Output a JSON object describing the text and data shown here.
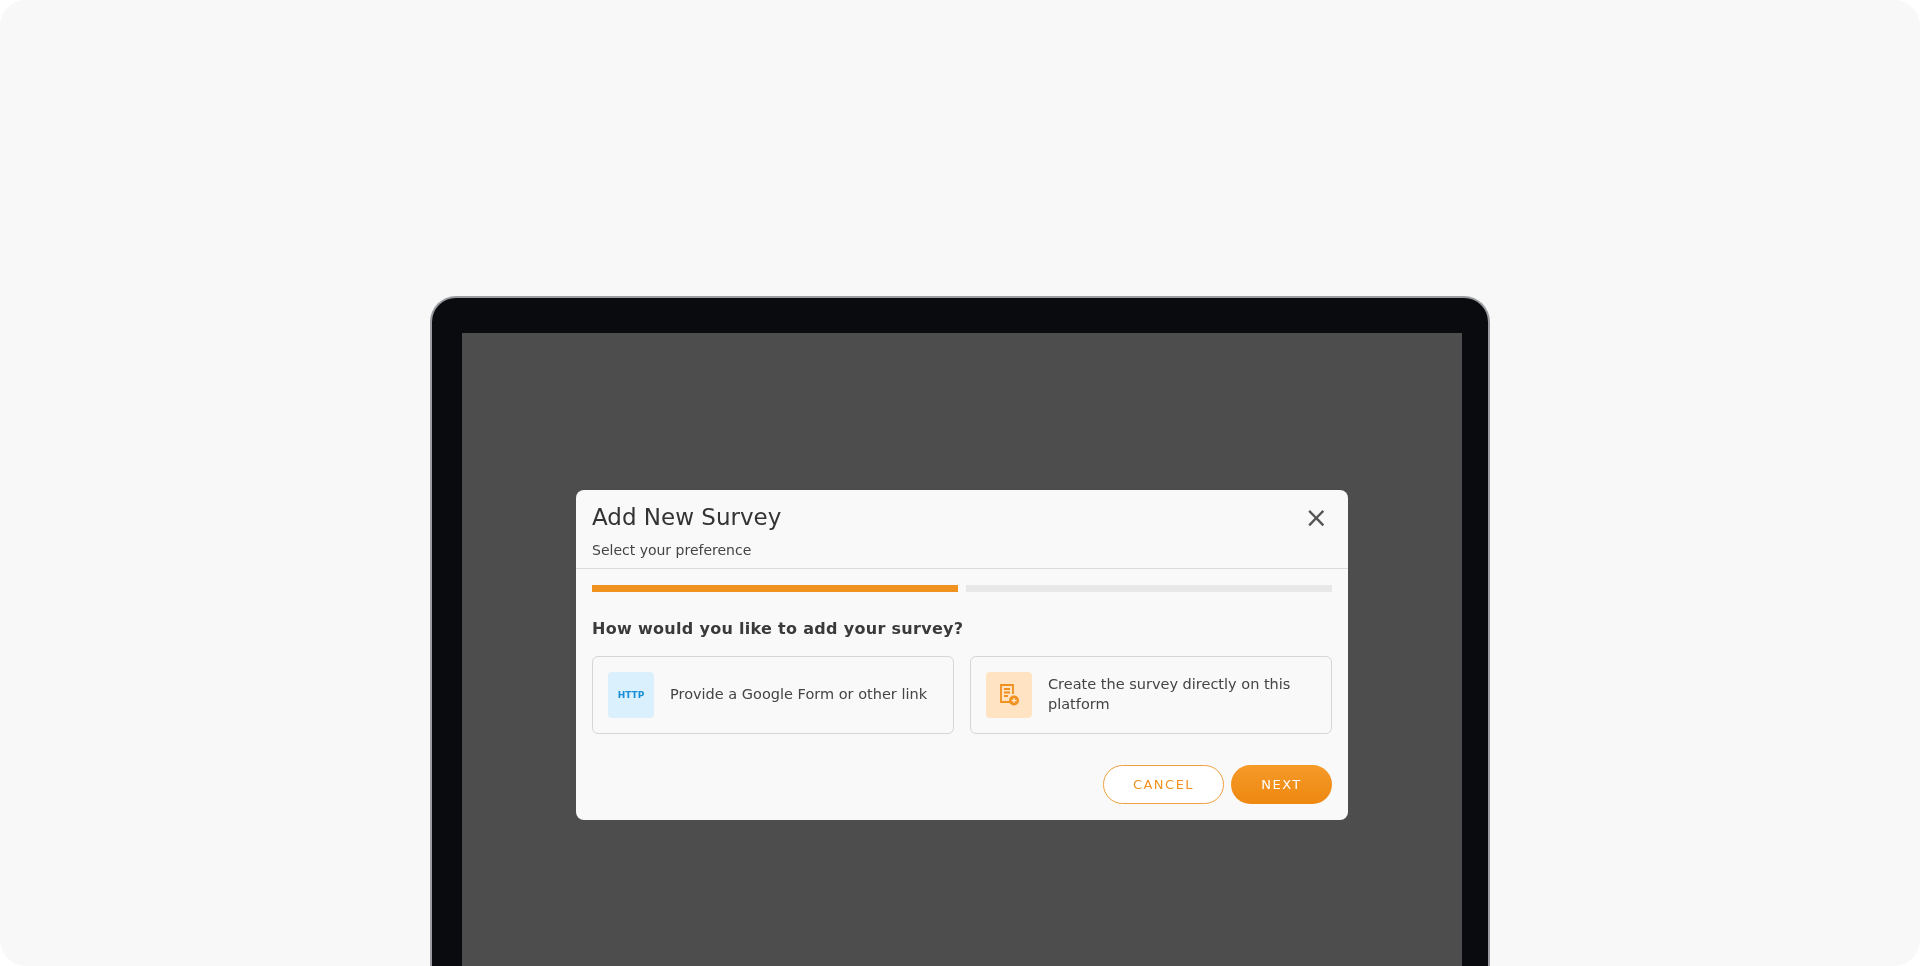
{
  "dialog": {
    "title": "Add New Survey",
    "subtitle": "Select your preference",
    "close": "×"
  },
  "steps": [
    {
      "complete": true
    },
    {
      "complete": false
    }
  ],
  "question": "How would you like to add your survey?",
  "options": [
    {
      "kind": "link",
      "icon_text": "HTTP",
      "label": "Provide a Google Form or other link",
      "selected": false
    },
    {
      "kind": "create",
      "label": "Create the survey directly on this platform",
      "selected": false
    }
  ],
  "buttons": [
    {
      "kind": "secondary",
      "label": "CANCEL"
    },
    {
      "kind": "primary",
      "label": "NEXT"
    }
  ]
}
